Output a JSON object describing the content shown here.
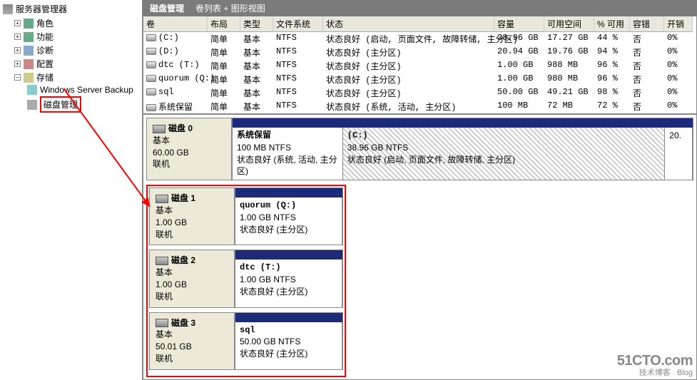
{
  "tree": {
    "root": "服务器管理器",
    "items": [
      {
        "label": "角色",
        "expand": "+"
      },
      {
        "label": "功能",
        "expand": "+"
      },
      {
        "label": "诊断",
        "expand": "+"
      },
      {
        "label": "配置",
        "expand": "+"
      },
      {
        "label": "存储",
        "expand": "−"
      }
    ],
    "storage_children": [
      {
        "label": "Windows Server Backup"
      },
      {
        "label": "磁盘管理"
      }
    ]
  },
  "title": {
    "main": "磁盘管理",
    "sub": "卷列表 + 图形视图"
  },
  "columns": [
    "卷",
    "布局",
    "类型",
    "文件系统",
    "状态",
    "容量",
    "可用空间",
    "% 可用",
    "容错",
    "开销"
  ],
  "volumes": [
    {
      "name": "(C:)",
      "layout": "简单",
      "type": "基本",
      "fs": "NTFS",
      "status": "状态良好 (启动, 页面文件, 故障转储, 主分区)",
      "cap": "38.96 GB",
      "free": "17.27 GB",
      "pct": "44 %",
      "ft": "否",
      "oh": "0%"
    },
    {
      "name": "(D:)",
      "layout": "简单",
      "type": "基本",
      "fs": "NTFS",
      "status": "状态良好 (主分区)",
      "cap": "20.94 GB",
      "free": "19.76 GB",
      "pct": "94 %",
      "ft": "否",
      "oh": "0%"
    },
    {
      "name": "dtc (T:)",
      "layout": "简单",
      "type": "基本",
      "fs": "NTFS",
      "status": "状态良好 (主分区)",
      "cap": "1.00 GB",
      "free": "988 MB",
      "pct": "96 %",
      "ft": "否",
      "oh": "0%"
    },
    {
      "name": "quorum (Q:)",
      "layout": "简单",
      "type": "基本",
      "fs": "NTFS",
      "status": "状态良好 (主分区)",
      "cap": "1.00 GB",
      "free": "980 MB",
      "pct": "96 %",
      "ft": "否",
      "oh": "0%"
    },
    {
      "name": "sql",
      "layout": "简单",
      "type": "基本",
      "fs": "NTFS",
      "status": "状态良好 (主分区)",
      "cap": "50.00 GB",
      "free": "49.21 GB",
      "pct": "98 %",
      "ft": "否",
      "oh": "0%"
    },
    {
      "name": "系统保留",
      "layout": "简单",
      "type": "基本",
      "fs": "NTFS",
      "status": "状态良好 (系统, 活动, 主分区)",
      "cap": "100 MB",
      "free": "72 MB",
      "pct": "72 %",
      "ft": "否",
      "oh": "0%"
    }
  ],
  "disks": [
    {
      "name": "磁盘 0",
      "type": "基本",
      "size": "60.00 GB",
      "state": "联机",
      "highlight": false,
      "partitions": [
        {
          "title": "系统保留",
          "sub": "100 MB NTFS",
          "status": "状态良好 (系统, 活动, 主分区)",
          "w": "24%",
          "hatch": false
        },
        {
          "title": "(C:)",
          "sub": "38.96 GB NTFS",
          "status": "状态良好 (启动, 页面文件, 故障转储, 主分区)",
          "w": "70%",
          "hatch": true
        },
        {
          "title": "",
          "sub": "20.",
          "status": "",
          "w": "6%",
          "hatch": false
        }
      ]
    },
    {
      "name": "磁盘 1",
      "type": "基本",
      "size": "1.00 GB",
      "state": "联机",
      "highlight": true,
      "partitions": [
        {
          "title": "quorum  (Q:)",
          "sub": "1.00 GB NTFS",
          "status": "状态良好 (主分区)",
          "w": "100%",
          "hatch": false
        }
      ]
    },
    {
      "name": "磁盘 2",
      "type": "基本",
      "size": "1.00 GB",
      "state": "联机",
      "highlight": true,
      "partitions": [
        {
          "title": "dtc   (T:)",
          "sub": "1.00 GB NTFS",
          "status": "状态良好 (主分区)",
          "w": "100%",
          "hatch": false
        }
      ]
    },
    {
      "name": "磁盘 3",
      "type": "基本",
      "size": "50.01 GB",
      "state": "联机",
      "highlight": true,
      "partitions": [
        {
          "title": "sql",
          "sub": "50.00 GB NTFS",
          "status": "状态良好 (主分区)",
          "w": "100%",
          "hatch": false
        }
      ]
    }
  ],
  "watermark": {
    "line1": "51CTO.com",
    "line2": "技术博客",
    "line3": "Blog"
  }
}
